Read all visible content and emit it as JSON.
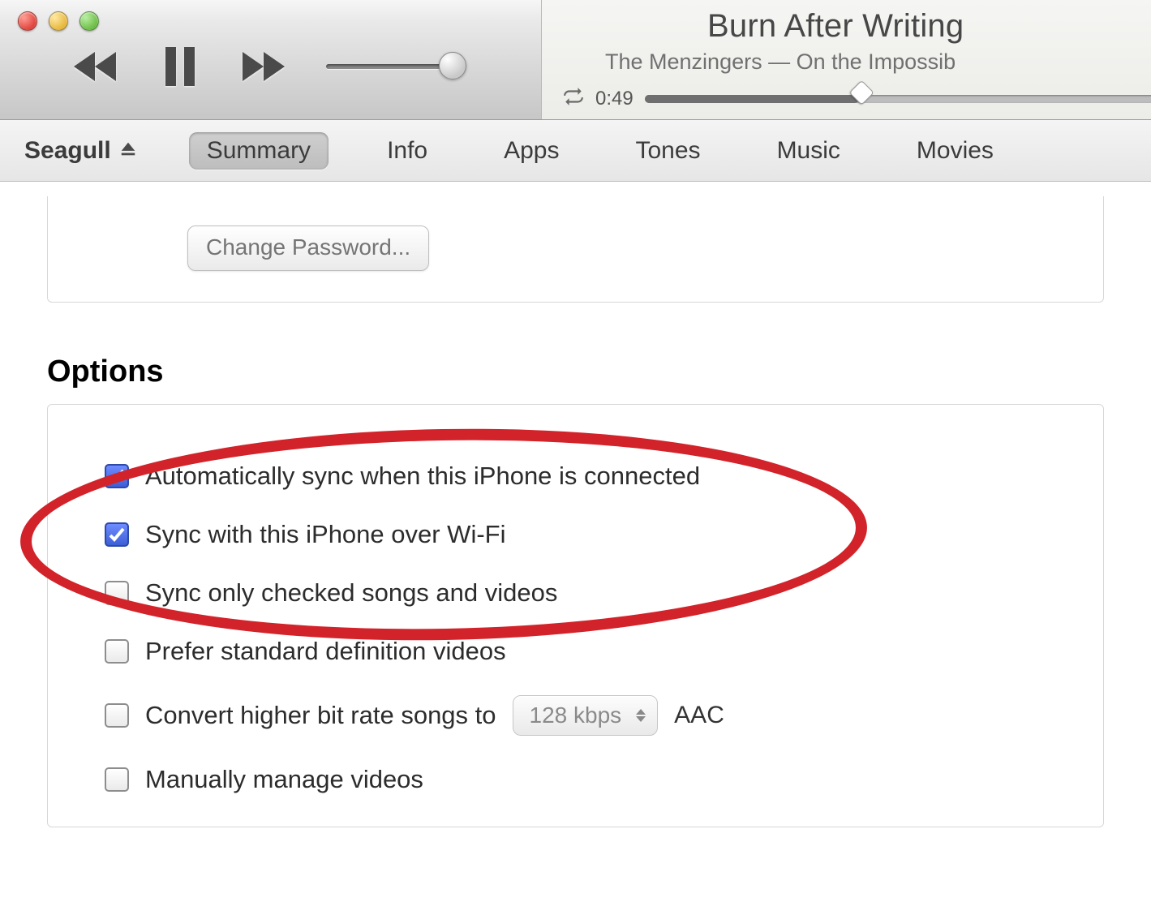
{
  "now_playing": {
    "title": "Burn After Writing",
    "artist_album": "The Menzingers — On the Impossib",
    "elapsed": "0:49"
  },
  "device_name": "Seagull",
  "tabs": {
    "summary": "Summary",
    "info": "Info",
    "apps": "Apps",
    "tones": "Tones",
    "music": "Music",
    "movies": "Movies"
  },
  "change_password_label": "Change Password...",
  "options_heading": "Options",
  "options": {
    "auto_sync": {
      "label": "Automatically sync when this iPhone is connected",
      "checked": true
    },
    "wifi_sync": {
      "label": "Sync with this iPhone over Wi-Fi",
      "checked": true
    },
    "only_checked": {
      "label": "Sync only checked songs and videos",
      "checked": false
    },
    "prefer_sd": {
      "label": "Prefer standard definition videos",
      "checked": false
    },
    "convert": {
      "label": "Convert higher bit rate songs to",
      "checked": false,
      "bitrate_value": "128 kbps",
      "suffix": "AAC"
    },
    "manual": {
      "label": "Manually manage videos",
      "checked": false
    }
  },
  "colors": {
    "annotation": "#d2232a"
  }
}
